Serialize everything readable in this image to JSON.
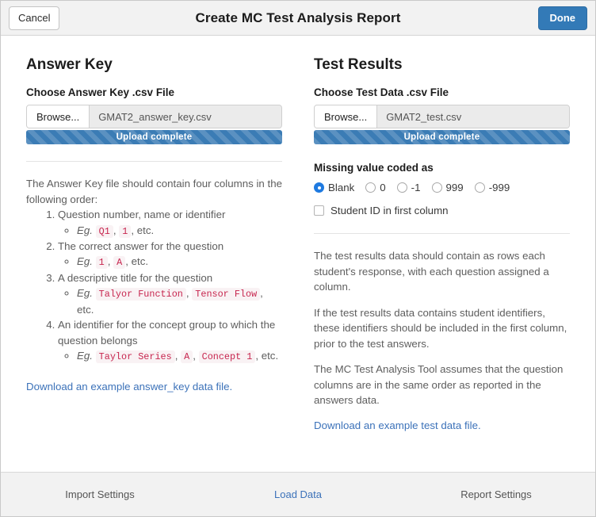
{
  "header": {
    "title": "Create MC Test Analysis Report",
    "cancel_label": "Cancel",
    "done_label": "Done"
  },
  "colors": {
    "accent": "#337ab7",
    "link": "#3c72b9",
    "progress": "#3b7cb5",
    "code_text": "#c7254e",
    "code_bg": "#f9f2f4",
    "radio_on": "#1f7ae0"
  },
  "answer_key": {
    "section_title": "Answer Key",
    "file_label": "Choose Answer Key .csv File",
    "browse_label": "Browse...",
    "file_name": "GMAT2_answer_key.csv",
    "progress_text": "Upload complete",
    "intro": "The Answer Key file should contain four columns in the following order:",
    "columns": [
      {
        "text": "Question number, name or identifier",
        "eg_label": "Eg.",
        "eg_codes": [
          "Q1",
          "1"
        ],
        "eg_suffix": ", etc."
      },
      {
        "text": "The correct answer for the question",
        "eg_label": "Eg.",
        "eg_codes": [
          "1",
          "A"
        ],
        "eg_suffix": ", etc."
      },
      {
        "text": "A descriptive title for the question",
        "eg_label": "Eg.",
        "eg_codes": [
          "Talyor Function",
          "Tensor Flow"
        ],
        "eg_suffix": ", etc."
      },
      {
        "text": "An identifier for the concept group to which the question belongs",
        "eg_label": "Eg.",
        "eg_codes": [
          "Taylor Series",
          "A",
          "Concept 1"
        ],
        "eg_suffix": ", etc."
      }
    ],
    "download_link": "Download an example answer_key data file."
  },
  "test_results": {
    "section_title": "Test Results",
    "file_label": "Choose Test Data .csv File",
    "browse_label": "Browse...",
    "file_name": "GMAT2_test.csv",
    "progress_text": "Upload complete",
    "missing_label": "Missing value coded as",
    "missing_options": [
      "Blank",
      "0",
      "-1",
      "999",
      "-999"
    ],
    "missing_selected": "Blank",
    "student_id_label": "Student ID in first column",
    "student_id_checked": false,
    "paragraphs": [
      "The test results data should contain as rows each student's response, with each question assigned a column.",
      "If the test results data contains student identifiers, these identifiers should be included in the first column, prior to the test answers.",
      "The MC Test Analysis Tool assumes that the question columns are in the same order as reported in the answers data."
    ],
    "download_link": "Download an example test data file."
  },
  "tabs": [
    {
      "label": "Import Settings",
      "active": false
    },
    {
      "label": "Load Data",
      "active": true
    },
    {
      "label": "Report Settings",
      "active": false
    }
  ]
}
